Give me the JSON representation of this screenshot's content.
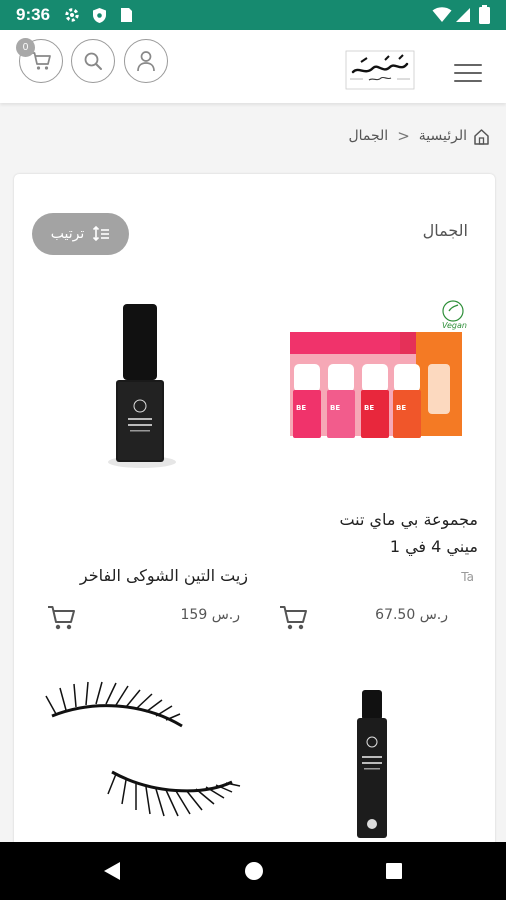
{
  "status_bar": {
    "time": "9:36"
  },
  "header": {
    "cart_count": "0",
    "logo_text": "دكاني"
  },
  "breadcrumb": {
    "home": "الرئيسية",
    "separator": ">",
    "current": "الجمال"
  },
  "section": {
    "title": "الجمال",
    "sort_label": "ترتيب"
  },
  "products": [
    {
      "name_line1": "مجموعة بي ماي تنت",
      "name_line2": "ميني 4 في 1",
      "vendor": "Ta",
      "price": "67.50 ر.س"
    },
    {
      "name_line1": "زيت التين الشوكى الفاخر",
      "name_line2": "",
      "vendor": "",
      "price": "159 ر.س"
    }
  ],
  "colors": {
    "status_bar": "#168a6f",
    "sort_button": "#a3a3a3",
    "lip_pink": "#f0336b",
    "lip_red": "#e8273c",
    "lip_orange": "#f0562a"
  }
}
